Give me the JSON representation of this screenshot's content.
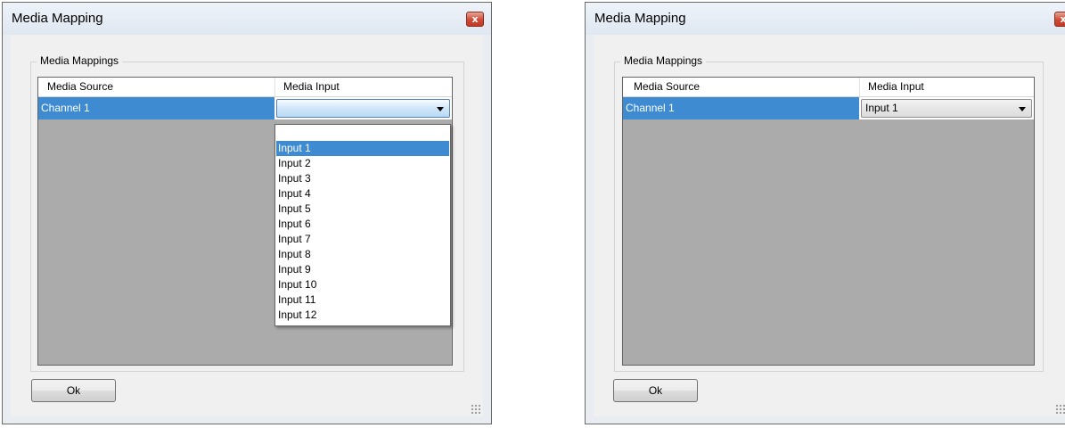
{
  "left_window": {
    "title": "Media Mapping",
    "close_glyph": "x",
    "group_label": "Media Mappings",
    "columns": [
      "Media Source",
      "Media Input"
    ],
    "row": {
      "source": "Channel 1",
      "input": ""
    },
    "dropdown_open": true,
    "dropdown_options": [
      "",
      "Input 1",
      "Input 2",
      "Input 3",
      "Input 4",
      "Input 5",
      "Input 6",
      "Input 7",
      "Input 8",
      "Input 9",
      "Input 10",
      "Input 11",
      "Input 12"
    ],
    "highlighted_option": "Input 1",
    "ok_label": "Ok"
  },
  "right_window": {
    "title": "Media Mapping",
    "close_glyph": "x",
    "group_label": "Media Mappings",
    "columns": [
      "Media Source",
      "Media Input"
    ],
    "row": {
      "source": "Channel 1",
      "input": "Input 1"
    },
    "dropdown_open": false,
    "ok_label": "Ok"
  },
  "colors": {
    "selection": "#3e8bd1",
    "grid_background": "#ababab",
    "close_button": "#c8432e"
  }
}
